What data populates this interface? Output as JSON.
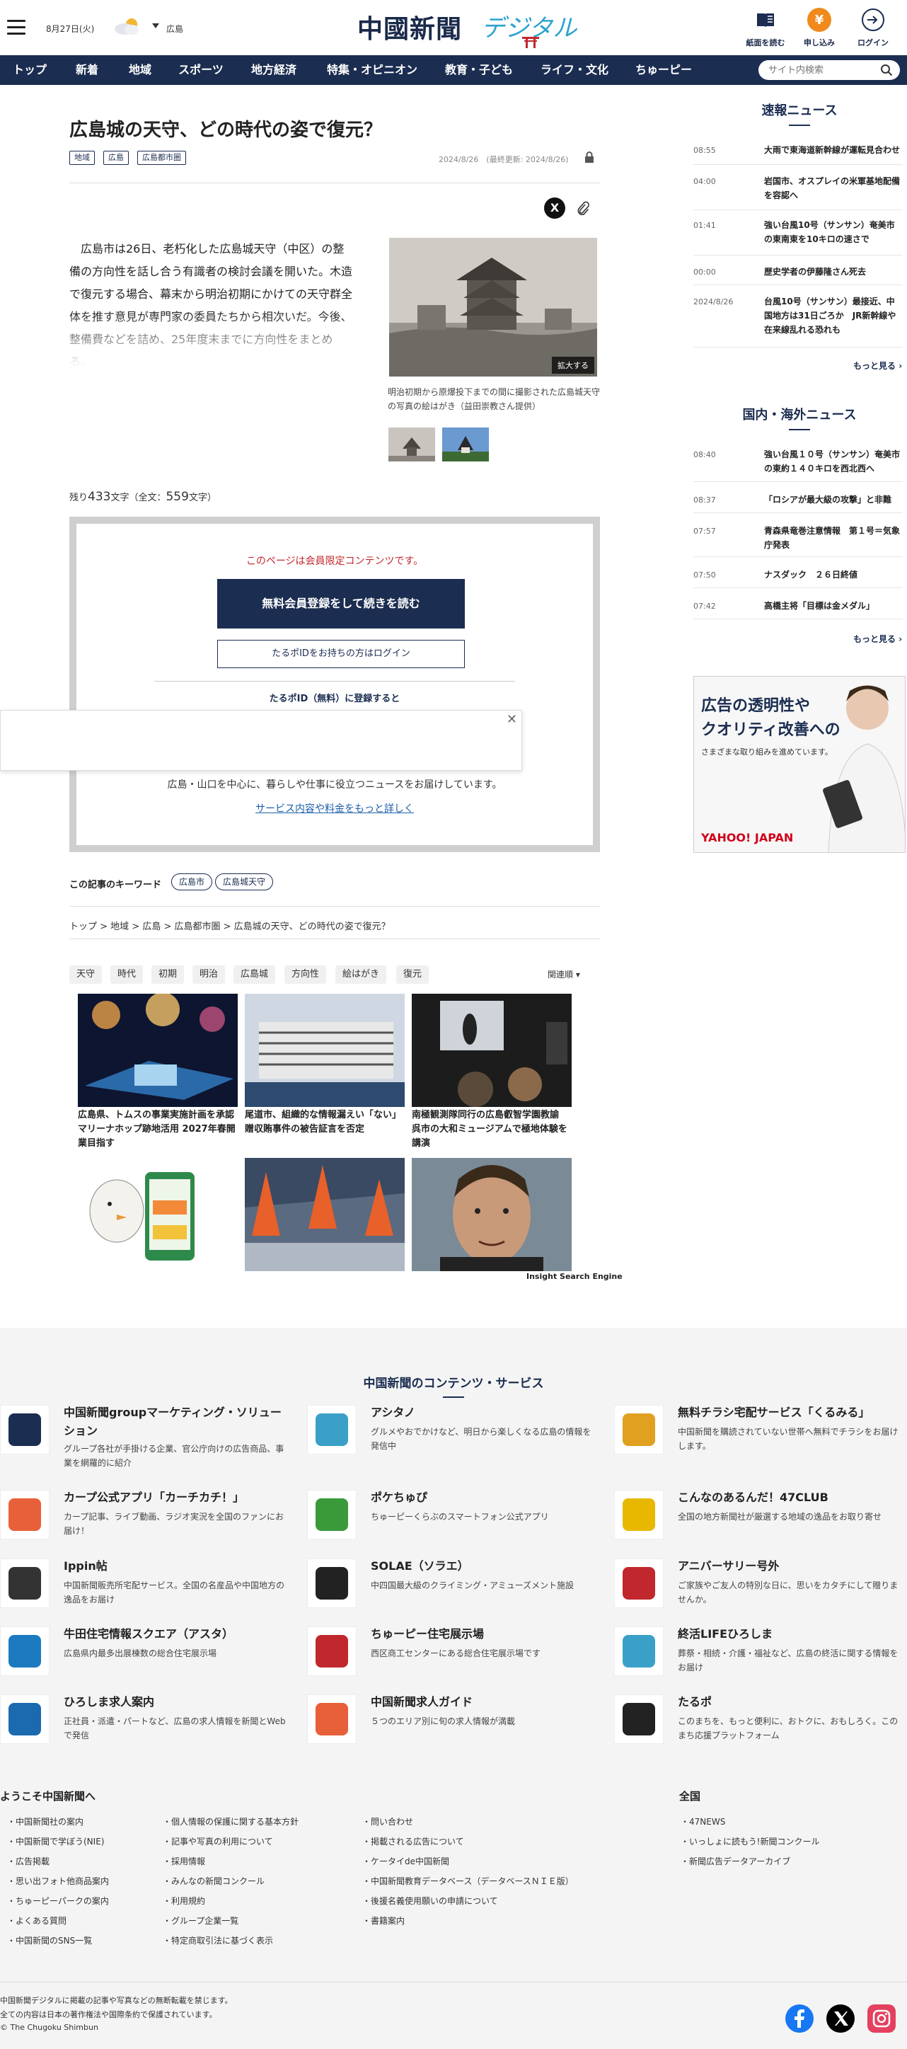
{
  "header": {
    "date": "8月27日(火)",
    "region": "広島",
    "logo_main": "中國新聞",
    "logo_sub": "デジタル",
    "buttons": [
      {
        "label": "紙面を読む",
        "icon": "newspaper-icon"
      },
      {
        "label": "申し込み",
        "icon": "coin-icon"
      },
      {
        "label": "ログイン",
        "icon": "login-icon"
      }
    ]
  },
  "nav": {
    "items": [
      "トップ",
      "新着",
      "地域",
      "スポーツ",
      "地方経済",
      "特集・オピニオン",
      "教育・子ども",
      "ライフ・文化",
      "ちゅーピー"
    ],
    "search_placeholder": "サイト内検索"
  },
  "article": {
    "title": "広島城の天守、どの時代の姿で復元？",
    "tags": [
      "地域",
      "広島",
      "広島都市圏"
    ],
    "date": "2024/8/26　(最終更新: 2024/8/26)",
    "body": "　広島市は26日、老朽化した広島城天守（中区）の整備の方向性を話し合う有識者の検討会議を開いた。木造で復元する場合、幕末から明治初期にかけての天守群全体を推す意見が専門家の委員たちから相次いだ。今後、整備費などを詰め、25年度末までに方向性をまとめる。",
    "photo_button": "拡大する",
    "caption": "明治初期から原爆投下までの間に撮影された広島城天守の写真の絵はがき（益田崇教さん提供）",
    "remaining_prefix": "残り",
    "remaining_count": "433",
    "remaining_suffix": "文字（全文：",
    "total_count": "559",
    "total_suffix": "文字）"
  },
  "paywall": {
    "message": "このページは会員限定コンテンツです。",
    "register_button": "無料会員登録をして続きを読む",
    "login_button": "たるポIDをお持ちの方はログイン",
    "register_note": "たるポID（無料）に登録すると",
    "description": "広島・山口を中心に、暮らしや仕事に役立つニュースをお届けしています。",
    "more_link": "サービス内容や料金をもっと詳しく"
  },
  "keywords": {
    "label": "この記事のキーワード",
    "items": [
      "広島市",
      "広島城天守"
    ]
  },
  "breadcrumb": "トップ > 地域 > 広島 > 広島都市圏 > 広島城の天守、どの時代の姿で復元？",
  "chips": [
    "天守",
    "時代",
    "初期",
    "明治",
    "広島城",
    "方向性",
    "絵はがき",
    "復元"
  ],
  "sort_label": "関連順",
  "related": [
    "広島県、トムスの事業実施計画を承認　マリーナホップ跡地活用 2027年春開業目指す",
    "尾道市、組織的な情報漏えい「ない」 贈収賄事件の被告証言を否定",
    "南極観測隊同行の広島叡智学園教諭　呉市の大和ミュージアムで極地体験を講演"
  ],
  "ad_credit": "Insight Search Engine",
  "sidebar": {
    "flash_title": "速報ニュース",
    "flash": [
      {
        "time": "08:55",
        "text": "大雨で東海道新幹線が運転見合わせ"
      },
      {
        "time": "04:00",
        "text": "岩国市、オスプレイの米軍基地配備を容認へ"
      },
      {
        "time": "01:41",
        "text": "強い台風10号（サンサン）奄美市の東南東を10キロの速さで"
      },
      {
        "time": "00:00",
        "text": "歴史学者の伊藤隆さん死去"
      },
      {
        "time": "2024/8/26",
        "text": "台風10号（サンサン）最接近、中国地方は31日ごろか　JR新幹線や在来線乱れる恐れも"
      }
    ],
    "more1": "もっと見る",
    "world_title": "国内・海外ニュース",
    "world": [
      {
        "time": "08:40",
        "text": "強い台風１０号（サンサン）奄美市の東約１４０キロを西北西へ"
      },
      {
        "time": "08:37",
        "text": "「ロシアが最大級の攻撃」と非難"
      },
      {
        "time": "07:57",
        "text": "青森県竜巻注意情報　第１号＝気象庁発表"
      },
      {
        "time": "07:50",
        "text": "ナスダック　２６日終値"
      },
      {
        "time": "07:42",
        "text": "高橋主将「目標は金メダル」"
      }
    ],
    "more2": "もっと見る",
    "ad": {
      "line1": "広告の透明性や",
      "line2": "クオリティ改善への",
      "line3": "さまざまな取り組みを進めています。",
      "brand": "YAHOO! JAPAN"
    }
  },
  "services": {
    "title": "中国新聞のコンテンツ・サービス",
    "items": [
      {
        "name": "中国新聞groupマーケティング・ソリューション",
        "desc": "グループ各社が手掛ける企業、官公庁向けの広告商品、事業を網羅的に紹介",
        "icon": "marketing-logo",
        "color": "#1b2d50"
      },
      {
        "name": "アシタノ",
        "desc": "グルメやおでかけなど、明日から楽しくなる広島の情報を発信中",
        "icon": "ashitano-logo",
        "color": "#3aa0c8"
      },
      {
        "name": "無料チラシ宅配サービス「くるみる」",
        "desc": "中国新聞を購読されていない世帯へ無料でチラシをお届けします。",
        "icon": "kurumiru-logo",
        "color": "#e0a020"
      },
      {
        "name": "カープ公式アプリ「カーチカチ！」",
        "desc": "カープ記事、ライブ動画、ラジオ実況を全国のファンにお届け！",
        "icon": "carp-app-logo",
        "color": "#e8603a"
      },
      {
        "name": "ポケちゅぴ",
        "desc": "ちゅーピーくらぶのスマートフォン公式アプリ",
        "icon": "pokechupi-logo",
        "color": "#3a9a3a"
      },
      {
        "name": "こんなのあるんだ！47CLUB",
        "desc": "全国の地方新聞社が厳選する地域の逸品をお取り寄せ",
        "icon": "47club-logo",
        "color": "#e8b800"
      },
      {
        "name": "Ippin帖",
        "desc": "中国新聞販売所宅配サービス。全国の名産品や中国地方の逸品をお届け",
        "icon": "ippin-logo",
        "color": "#333333"
      },
      {
        "name": "SOLAE（ソラエ）",
        "desc": "中四国最大級のクライミング・アミューズメント施設",
        "icon": "solae-logo",
        "color": "#222222"
      },
      {
        "name": "アニバーサリー号外",
        "desc": "ご家族やご友人の特別な日に、思いをカタチにして贈りませんか。",
        "icon": "anniversary-logo",
        "color": "#c0282d"
      },
      {
        "name": "牛田住宅情報スクエア（アスタ）",
        "desc": "広島県内最多出展棟数の総合住宅展示場",
        "icon": "asta-logo",
        "color": "#1b7ac0"
      },
      {
        "name": "ちゅーピー住宅展示場",
        "desc": "西区商工センターにある総合住宅展示場です",
        "icon": "chupy-house-logo",
        "color": "#c0282d"
      },
      {
        "name": "終活LIFEひろしま",
        "desc": "葬祭・相続・介護・福祉など、広島の終活に関する情報をお届け",
        "icon": "shukatsu-logo",
        "color": "#3aa0c8"
      },
      {
        "name": "ひろしま求人案内",
        "desc": "正社員・派遣・パートなど、広島の求人情報を新聞とWebで発信",
        "icon": "hiroshima-job-logo",
        "color": "#1b6ab0"
      },
      {
        "name": "中国新聞求人ガイド",
        "desc": "５つのエリア別に旬の求人情報が満載",
        "icon": "job-guide-logo",
        "color": "#e8603a"
      },
      {
        "name": "たるポ",
        "desc": "このまちを、もっと便利に、おトクに、おもしろく。このまち応援プラットフォーム",
        "icon": "tarupo-logo",
        "color": "#222222"
      }
    ]
  },
  "footer_links": {
    "heading1": "ようこそ中国新聞へ",
    "col1": [
      "中国新聞社の案内",
      "中国新聞で学ぼう(NIE)",
      "広告掲載",
      "思い出フォト他商品案内",
      "ちゅーピーパークの案内",
      "よくある質問",
      "中国新聞のSNS一覧"
    ],
    "col2": [
      "個人情報の保護に関する基本方針",
      "記事や写真の利用について",
      "採用情報",
      "みんなの新聞コンクール",
      "利用規約",
      "グループ企業一覧",
      "特定商取引法に基づく表示"
    ],
    "col3": [
      "問い合わせ",
      "掲載される広告について",
      "ケータイde中国新聞",
      "中国新聞教育データベース（データベースＮＩＥ版）",
      "後援名義使用願いの申請について",
      "書籍案内"
    ],
    "heading2": "全国",
    "col4": [
      "47NEWS",
      "いっしょに読もう!新聞コンクール",
      "新聞広告データアーカイブ"
    ]
  },
  "copyright": {
    "line1": "中国新聞デジタルに掲載の記事や写真などの無断転載を禁じます。",
    "line2": "全ての内容は日本の著作権法や国際条約で保護されています。",
    "line3": "© The Chugoku Shimbun"
  },
  "sns": [
    "facebook-icon",
    "x-icon",
    "instagram-icon"
  ]
}
